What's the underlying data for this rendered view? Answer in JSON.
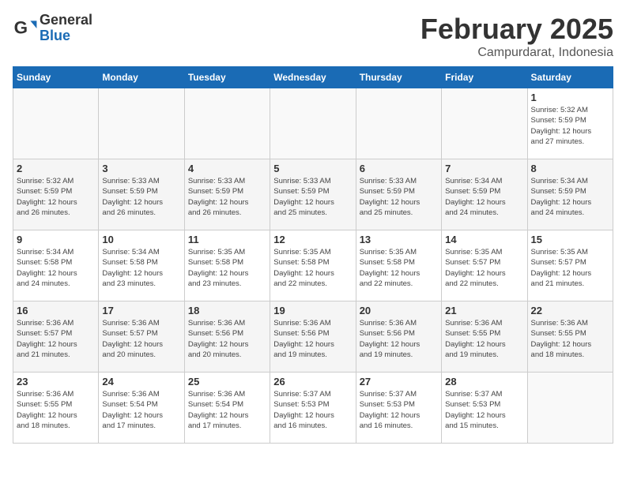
{
  "header": {
    "logo_general": "General",
    "logo_blue": "Blue",
    "month_year": "February 2025",
    "location": "Campurdarat, Indonesia"
  },
  "weekdays": [
    "Sunday",
    "Monday",
    "Tuesday",
    "Wednesday",
    "Thursday",
    "Friday",
    "Saturday"
  ],
  "weeks": [
    [
      {
        "day": "",
        "info": ""
      },
      {
        "day": "",
        "info": ""
      },
      {
        "day": "",
        "info": ""
      },
      {
        "day": "",
        "info": ""
      },
      {
        "day": "",
        "info": ""
      },
      {
        "day": "",
        "info": ""
      },
      {
        "day": "1",
        "info": "Sunrise: 5:32 AM\nSunset: 5:59 PM\nDaylight: 12 hours\nand 27 minutes."
      }
    ],
    [
      {
        "day": "2",
        "info": "Sunrise: 5:32 AM\nSunset: 5:59 PM\nDaylight: 12 hours\nand 26 minutes."
      },
      {
        "day": "3",
        "info": "Sunrise: 5:33 AM\nSunset: 5:59 PM\nDaylight: 12 hours\nand 26 minutes."
      },
      {
        "day": "4",
        "info": "Sunrise: 5:33 AM\nSunset: 5:59 PM\nDaylight: 12 hours\nand 26 minutes."
      },
      {
        "day": "5",
        "info": "Sunrise: 5:33 AM\nSunset: 5:59 PM\nDaylight: 12 hours\nand 25 minutes."
      },
      {
        "day": "6",
        "info": "Sunrise: 5:33 AM\nSunset: 5:59 PM\nDaylight: 12 hours\nand 25 minutes."
      },
      {
        "day": "7",
        "info": "Sunrise: 5:34 AM\nSunset: 5:59 PM\nDaylight: 12 hours\nand 24 minutes."
      },
      {
        "day": "8",
        "info": "Sunrise: 5:34 AM\nSunset: 5:59 PM\nDaylight: 12 hours\nand 24 minutes."
      }
    ],
    [
      {
        "day": "9",
        "info": "Sunrise: 5:34 AM\nSunset: 5:58 PM\nDaylight: 12 hours\nand 24 minutes."
      },
      {
        "day": "10",
        "info": "Sunrise: 5:34 AM\nSunset: 5:58 PM\nDaylight: 12 hours\nand 23 minutes."
      },
      {
        "day": "11",
        "info": "Sunrise: 5:35 AM\nSunset: 5:58 PM\nDaylight: 12 hours\nand 23 minutes."
      },
      {
        "day": "12",
        "info": "Sunrise: 5:35 AM\nSunset: 5:58 PM\nDaylight: 12 hours\nand 22 minutes."
      },
      {
        "day": "13",
        "info": "Sunrise: 5:35 AM\nSunset: 5:58 PM\nDaylight: 12 hours\nand 22 minutes."
      },
      {
        "day": "14",
        "info": "Sunrise: 5:35 AM\nSunset: 5:57 PM\nDaylight: 12 hours\nand 22 minutes."
      },
      {
        "day": "15",
        "info": "Sunrise: 5:35 AM\nSunset: 5:57 PM\nDaylight: 12 hours\nand 21 minutes."
      }
    ],
    [
      {
        "day": "16",
        "info": "Sunrise: 5:36 AM\nSunset: 5:57 PM\nDaylight: 12 hours\nand 21 minutes."
      },
      {
        "day": "17",
        "info": "Sunrise: 5:36 AM\nSunset: 5:57 PM\nDaylight: 12 hours\nand 20 minutes."
      },
      {
        "day": "18",
        "info": "Sunrise: 5:36 AM\nSunset: 5:56 PM\nDaylight: 12 hours\nand 20 minutes."
      },
      {
        "day": "19",
        "info": "Sunrise: 5:36 AM\nSunset: 5:56 PM\nDaylight: 12 hours\nand 19 minutes."
      },
      {
        "day": "20",
        "info": "Sunrise: 5:36 AM\nSunset: 5:56 PM\nDaylight: 12 hours\nand 19 minutes."
      },
      {
        "day": "21",
        "info": "Sunrise: 5:36 AM\nSunset: 5:55 PM\nDaylight: 12 hours\nand 19 minutes."
      },
      {
        "day": "22",
        "info": "Sunrise: 5:36 AM\nSunset: 5:55 PM\nDaylight: 12 hours\nand 18 minutes."
      }
    ],
    [
      {
        "day": "23",
        "info": "Sunrise: 5:36 AM\nSunset: 5:55 PM\nDaylight: 12 hours\nand 18 minutes."
      },
      {
        "day": "24",
        "info": "Sunrise: 5:36 AM\nSunset: 5:54 PM\nDaylight: 12 hours\nand 17 minutes."
      },
      {
        "day": "25",
        "info": "Sunrise: 5:36 AM\nSunset: 5:54 PM\nDaylight: 12 hours\nand 17 minutes."
      },
      {
        "day": "26",
        "info": "Sunrise: 5:37 AM\nSunset: 5:53 PM\nDaylight: 12 hours\nand 16 minutes."
      },
      {
        "day": "27",
        "info": "Sunrise: 5:37 AM\nSunset: 5:53 PM\nDaylight: 12 hours\nand 16 minutes."
      },
      {
        "day": "28",
        "info": "Sunrise: 5:37 AM\nSunset: 5:53 PM\nDaylight: 12 hours\nand 15 minutes."
      },
      {
        "day": "",
        "info": ""
      }
    ]
  ]
}
